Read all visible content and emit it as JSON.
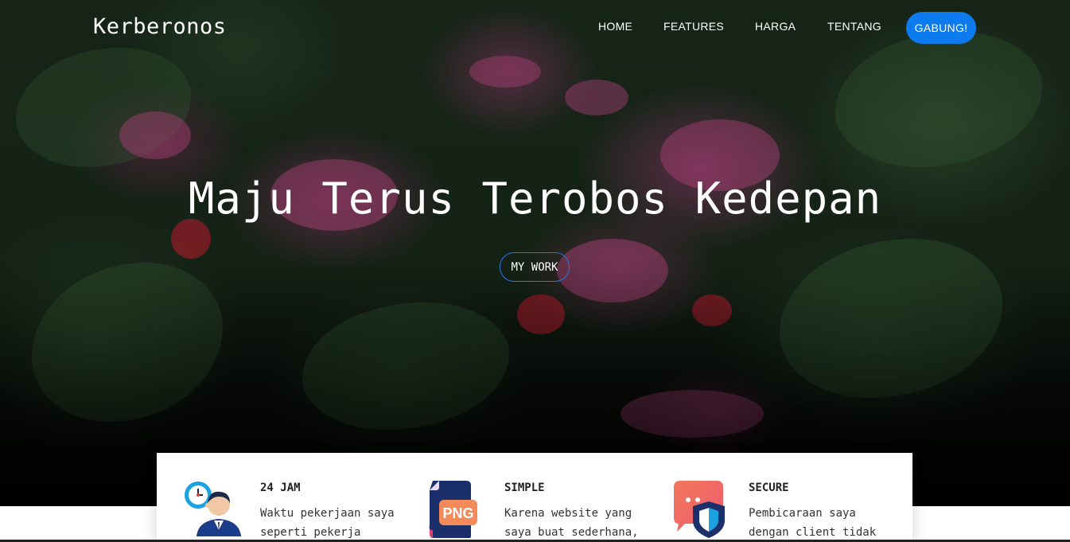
{
  "brand": "Kerberonos",
  "nav": {
    "items": [
      {
        "label": "HOME"
      },
      {
        "label": "FEATURES"
      },
      {
        "label": "HARGA"
      },
      {
        "label": "TENTANG"
      }
    ],
    "cta": "GABUNG!"
  },
  "hero": {
    "title": "Maju Terus Terobos Kedepan",
    "button": "MY WORK"
  },
  "features": [
    {
      "icon": "clock-person-icon",
      "title": "24 JAM",
      "desc": "Waktu pekerjaan saya seperti pekerja"
    },
    {
      "icon": "png-file-icon",
      "title": "SIMPLE",
      "desc": "Karena website yang saya buat sederhana,",
      "icon_text": "PNG"
    },
    {
      "icon": "chat-shield-icon",
      "title": "SECURE",
      "desc": "Pembicaraan saya dengan client tidak"
    }
  ],
  "colors": {
    "accent": "#0d7bf0",
    "hero_text": "#ffffff",
    "card_bg": "#ffffff"
  }
}
